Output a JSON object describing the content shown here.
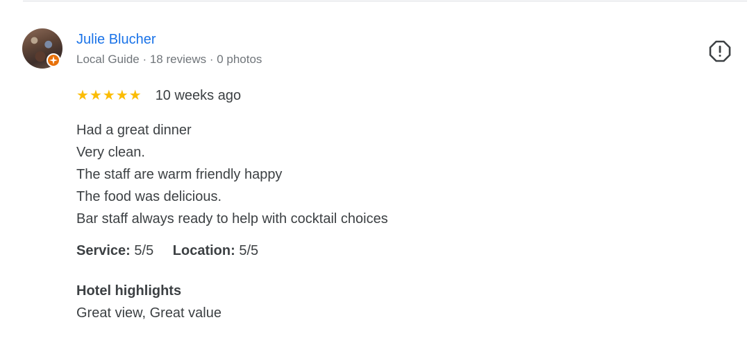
{
  "reviewer": {
    "name": "Julie Blucher",
    "meta": "Local Guide · 18 reviews · 0 photos"
  },
  "review": {
    "stars": 5,
    "date": "10 weeks ago",
    "lines": [
      "Had a great dinner",
      "Very clean.",
      "The staff are warm friendly happy",
      "The food was delicious.",
      "Bar staff always ready to help with cocktail choices"
    ]
  },
  "ratings": [
    {
      "label": "Service:",
      "value": "5/5"
    },
    {
      "label": "Location:",
      "value": "5/5"
    }
  ],
  "highlights": {
    "title": "Hotel highlights",
    "value": "Great view, Great value"
  },
  "icons": {
    "report": "report-flag-icon",
    "star": "star-icon",
    "local_guide_badge": "local-guide-badge-icon"
  },
  "colors": {
    "name_link": "#1a73e8",
    "star": "#fbbc04",
    "badge": "#e8710a",
    "muted_text": "#70757a",
    "body_text": "#3c4043"
  }
}
